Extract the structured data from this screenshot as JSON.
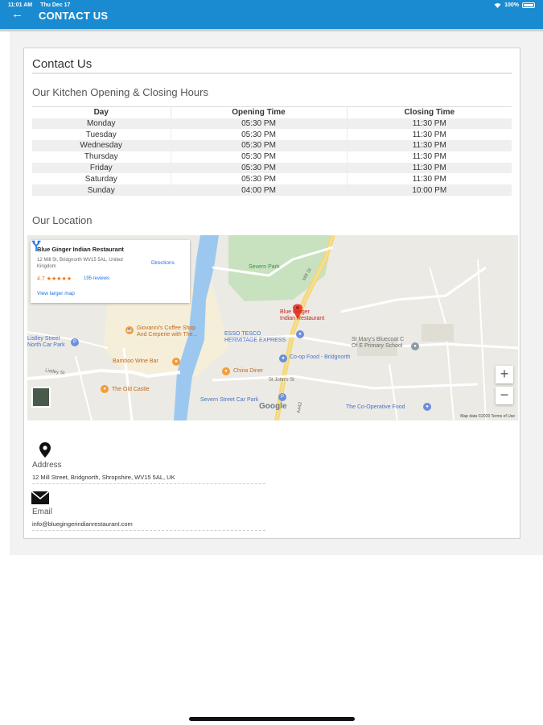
{
  "status_bar": {
    "time": "11:01 AM",
    "date": "Thu Dec 17",
    "battery": "100%"
  },
  "header": {
    "title": "CONTACT US",
    "back_icon": "back-arrow-icon"
  },
  "page": {
    "title": "Contact Us",
    "hours_title": "Our Kitchen Opening & Closing Hours",
    "table": {
      "headers": [
        "Day",
        "Opening Time",
        "Closing Time"
      ],
      "rows": [
        [
          "Monday",
          "05:30 PM",
          "11:30 PM"
        ],
        [
          "Tuesday",
          "05:30 PM",
          "11:30 PM"
        ],
        [
          "Wednesday",
          "05:30 PM",
          "11:30 PM"
        ],
        [
          "Thursday",
          "05:30 PM",
          "11:30 PM"
        ],
        [
          "Friday",
          "05:30 PM",
          "11:30 PM"
        ],
        [
          "Saturday",
          "05:30 PM",
          "11:30 PM"
        ],
        [
          "Sunday",
          "04:00 PM",
          "10:00 PM"
        ]
      ]
    },
    "location_title": "Our Location"
  },
  "map": {
    "info_card": {
      "name": "Blue Ginger Indian Restaurant",
      "address": "12 Mill St, Bridgnorth WV15 5AL, United Kingdom",
      "rating": "4.7",
      "stars": "★★★★★",
      "reviews": "195 reviews",
      "view_larger": "View larger map",
      "directions": "Directions"
    },
    "labels": {
      "severn_park": "Severn Park",
      "mill_st": "Mill St",
      "blue_ginger_1": "Blue Ginger",
      "blue_ginger_2": "Indian Restaurant",
      "giovannis_1": "Giovanni's Coffee Shop",
      "giovannis_2": "And Creperie with The...",
      "esso_1": "ESSO TESCO",
      "esso_2": "HERMITAGE EXPRESS",
      "coop": "Co-op Food - Bridgnorth",
      "stmarys_1": "St Mary's Bluecoat C",
      "stmarys_2": "Of E Primary School",
      "listley_1": "Listley Street",
      "listley_2": "North Car Park",
      "listley_st": "Listley St",
      "bamboo": "Bamboo Wine Bar",
      "china": "China Diner",
      "old_castle": "The Old Castle",
      "severn_car": "Severn Street Car Park",
      "coop_food": "The Co-Operative Food",
      "a442": "A442",
      "st_johns": "St John's St",
      "google": "Google",
      "map_data": "Map data ©2020   Terms of Use"
    },
    "zoom_in": "+",
    "zoom_out": "−"
  },
  "contact": {
    "address_label": "Address",
    "address_value": "12 Mill Street, Bridgnorth, Shropshire, WV15 5AL, UK",
    "email_label": "Email",
    "email_value": "info@bluegingerindianrestaurant.com"
  }
}
